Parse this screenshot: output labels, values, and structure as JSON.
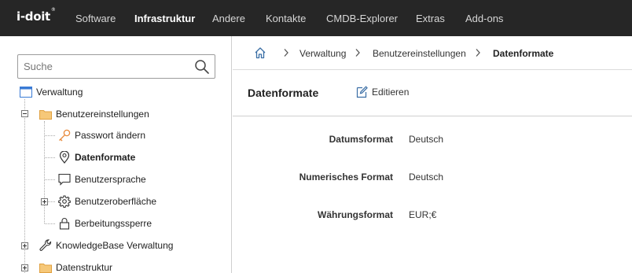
{
  "app": {
    "logo": "i-doit",
    "logo_mark": "®"
  },
  "nav": [
    {
      "label": "Software",
      "active": false
    },
    {
      "label": "Infrastruktur",
      "active": true
    },
    {
      "label": "Andere",
      "active": false
    },
    {
      "label": "Kontakte",
      "active": false
    },
    {
      "label": "CMDB-Explorer",
      "active": false
    },
    {
      "label": "Extras",
      "active": false
    },
    {
      "label": "Add-ons",
      "active": false
    }
  ],
  "sidebar": {
    "search": {
      "placeholder": "Suche",
      "value": ""
    },
    "tree": [
      {
        "label": "Verwaltung",
        "icon": "window-icon"
      },
      {
        "label": "Benutzereinstellungen",
        "icon": "folder-icon"
      },
      {
        "label": "Passwort ändern",
        "icon": "key-icon"
      },
      {
        "label": "Datenformate",
        "icon": "location-pin-icon",
        "selected": true
      },
      {
        "label": "Benutzersprache",
        "icon": "speech-bubble-icon"
      },
      {
        "label": "Benutzeroberfläche",
        "icon": "gear-icon"
      },
      {
        "label": "Berbeitungssperre",
        "icon": "lock-icon"
      },
      {
        "label": "KnowledgeBase Verwaltung",
        "icon": "wrench-icon"
      },
      {
        "label": "Datenstruktur",
        "icon": "folder-icon"
      }
    ]
  },
  "breadcrumb": {
    "home_icon": "home-icon",
    "items": [
      "Verwaltung",
      "Benutzereinstellungen",
      "Datenformate"
    ]
  },
  "content": {
    "title": "Datenformate",
    "edit_label": "Editieren",
    "fields": [
      {
        "label": "Datumsformat",
        "value": "Deutsch"
      },
      {
        "label": "Numerisches Format",
        "value": "Deutsch"
      },
      {
        "label": "Währungsformat",
        "value": "EUR;€"
      }
    ]
  },
  "colors": {
    "topbar": "#262626",
    "folder": "#f2b45a",
    "key": "#e8893a",
    "window": "#3a7bd5"
  }
}
